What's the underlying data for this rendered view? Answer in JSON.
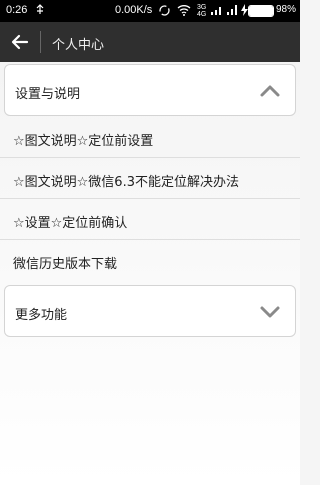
{
  "status_bar": {
    "time": "0:26",
    "speed": "0.00K/s",
    "battery_percent": "98%",
    "battery_level": 0.98,
    "icons": [
      "usb-icon",
      "sync-icon",
      "wifi-icon",
      "signal-3g-icon",
      "signal-icon",
      "charging-icon"
    ]
  },
  "action_bar": {
    "title": "个人中心",
    "back_icon": "arrow-left-icon"
  },
  "sections": {
    "settings": {
      "label": "设置与说明",
      "chevron": "chevron-up-icon",
      "expanded": true
    },
    "more": {
      "label": "更多功能",
      "chevron": "chevron-down-icon",
      "expanded": false
    }
  },
  "items": [
    {
      "label": "☆图文说明☆定位前设置"
    },
    {
      "label": "☆图文说明☆微信6.3不能定位解决办法"
    },
    {
      "label": "☆设置☆定位前确认"
    },
    {
      "label": "微信历史版本下载"
    }
  ],
  "colors": {
    "status_bar_bg": "#000000",
    "action_bar_bg": "#2f2f2f",
    "page_bg": "#f5f5f5",
    "card_border": "#d4d4d4",
    "chevron": "#8a8a8a"
  }
}
